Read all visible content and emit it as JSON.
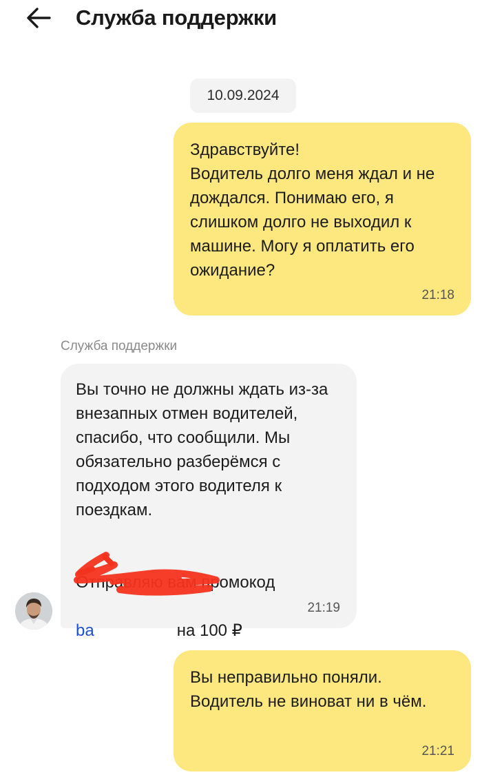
{
  "header": {
    "title": "Служба поддержки",
    "back_icon": "arrow-left-icon"
  },
  "chat": {
    "date_separator": "10.09.2024",
    "messages": [
      {
        "direction": "outgoing",
        "text": "Здравствуйте!\nВодитель долго меня ждал и не дождался. Понимаю его, я слишком долго не выходил к машине. Могу я оплатить его ожидание?",
        "time": "21:18"
      },
      {
        "direction": "incoming",
        "sender": "Служба поддержки",
        "text": "Вы точно не должны ждать из-за внезапных отмен водителей, спасибо, что сообщили. Мы обязательно разберёмся с подходом этого водителя к поездкам.",
        "promo_text": "Отправляю вам промокод",
        "promo_code": "ba",
        "promo_value": "на 100 ₽",
        "time": "21:19"
      },
      {
        "direction": "outgoing",
        "text": "Вы неправильно поняли. Водитель не виноват ни в чём.",
        "time": "21:21"
      }
    ]
  },
  "colors": {
    "outgoing_bubble": "#fde77f",
    "incoming_bubble": "#f3f3f3",
    "redaction_scribble": "#f4331f",
    "link": "#1d4fd6"
  }
}
